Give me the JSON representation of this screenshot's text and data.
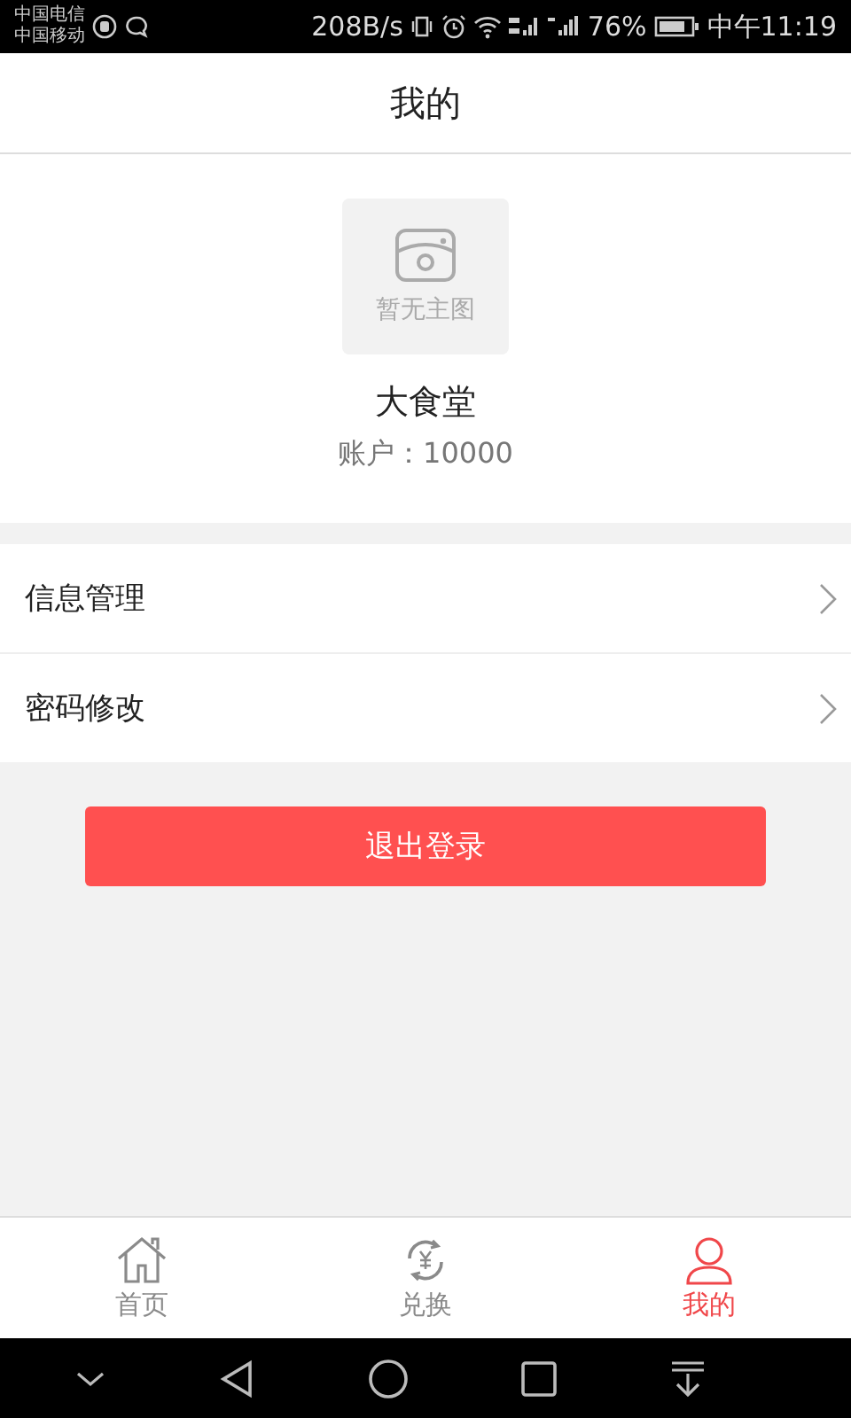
{
  "status_bar": {
    "carriers": [
      "中国电信",
      "中国移动"
    ],
    "speed": "208B/s",
    "battery": "76%",
    "time": "中午11:19"
  },
  "header": {
    "title": "我的"
  },
  "profile": {
    "image_placeholder": "暂无主图",
    "name": "大食堂",
    "account": "账户：10000"
  },
  "menu": [
    {
      "label": "信息管理"
    },
    {
      "label": "密码修改"
    }
  ],
  "logout_button": "退出登录",
  "tabs": [
    {
      "label": "首页",
      "kind": "home",
      "selected": false
    },
    {
      "label": "兑换",
      "kind": "exchange",
      "selected": false
    },
    {
      "label": "我的",
      "kind": "user",
      "selected": true
    }
  ]
}
